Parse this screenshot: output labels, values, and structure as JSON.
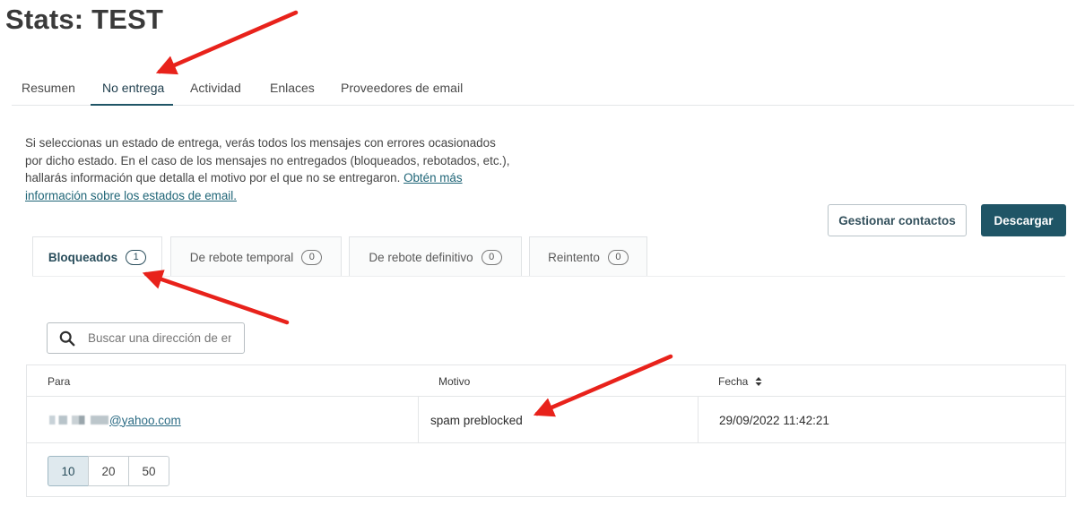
{
  "page": {
    "title": "Stats: TEST"
  },
  "main_tabs": [
    {
      "label": "Resumen"
    },
    {
      "label": "No entrega",
      "active": true
    },
    {
      "label": "Actividad"
    },
    {
      "label": "Enlaces"
    },
    {
      "label": "Proveedores de email"
    }
  ],
  "description": {
    "text": "Si seleccionas un estado de entrega, verás todos los mensajes con errores ocasionados por dicho estado. En el caso de los mensajes no entregados (bloqueados, rebotados, etc.), hallarás información que detalla el motivo por el que no se entregaron. ",
    "link": "Obtén más información sobre los estados de email."
  },
  "actions": {
    "manage_contacts": "Gestionar contactos",
    "download": "Descargar"
  },
  "sub_tabs": [
    {
      "label": "Bloqueados",
      "count": "1",
      "active": true
    },
    {
      "label": "De rebote temporal",
      "count": "0"
    },
    {
      "label": "De rebote definitivo",
      "count": "0"
    },
    {
      "label": "Reintento",
      "count": "0"
    }
  ],
  "search": {
    "placeholder": "Buscar una dirección de email"
  },
  "table": {
    "headers": {
      "to": "Para",
      "reason": "Motivo",
      "date": "Fecha",
      "sort_icon": "sort-icon"
    },
    "rows": [
      {
        "email": "@yahoo.com",
        "reason": "spam preblocked",
        "date": "29/09/2022 11:42:21"
      }
    ]
  },
  "pagination": {
    "options": [
      "10",
      "20",
      "50"
    ],
    "selected": "10"
  },
  "colors": {
    "primary": "#1f5566",
    "annotation_arrow": "#e8221b",
    "link": "#2a6a83"
  }
}
